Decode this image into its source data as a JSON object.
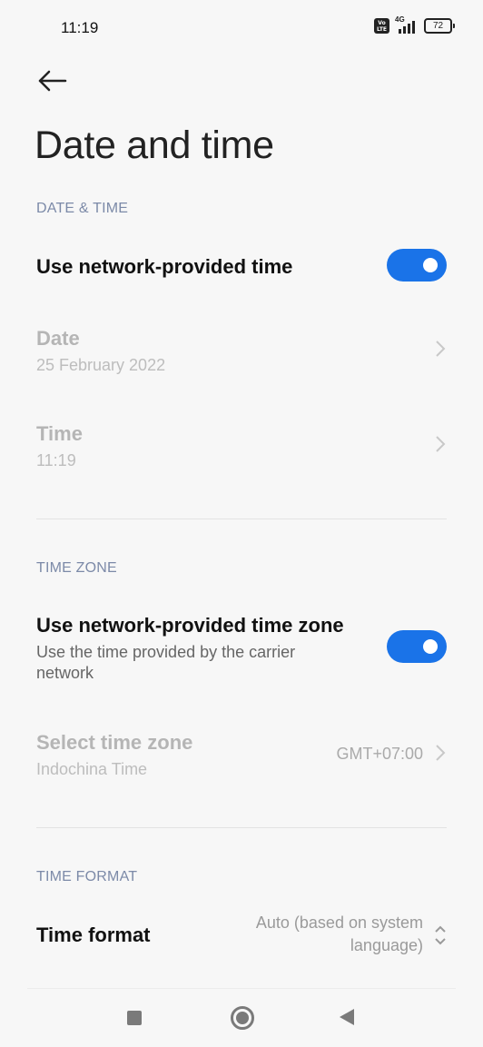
{
  "status_bar": {
    "time": "11:19",
    "volte_line1": "Vo",
    "volte_line2": "LTE",
    "network": "4G",
    "battery": "72"
  },
  "page": {
    "title": "Date and time"
  },
  "sections": {
    "date_time": {
      "header": "DATE & TIME",
      "network_time": {
        "title": "Use network-provided time",
        "enabled": true
      },
      "date": {
        "title": "Date",
        "value": "25 February 2022"
      },
      "time": {
        "title": "Time",
        "value": "11:19"
      }
    },
    "time_zone": {
      "header": "TIME ZONE",
      "network_zone": {
        "title": "Use network-provided time zone",
        "subtitle": "Use the time provided by the carrier network",
        "enabled": true
      },
      "select_zone": {
        "title": "Select time zone",
        "subtitle": "Indochina Time",
        "value": "GMT+07:00"
      }
    },
    "time_format": {
      "header": "TIME FORMAT",
      "format": {
        "title": "Time format",
        "value": "Auto (based on system language)"
      }
    }
  },
  "colors": {
    "accent": "#1a73e8",
    "section_header": "#7c8aa8",
    "disabled_text": "#b5b5b5"
  },
  "icons": [
    "back-arrow-icon",
    "chevron-right-icon",
    "chevron-updown-icon",
    "recents-icon",
    "home-icon",
    "back-triangle-icon"
  ]
}
